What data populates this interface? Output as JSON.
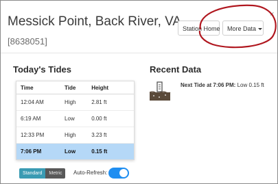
{
  "header": {
    "title": "Messick Point, Back River, VA",
    "station_id": "[8638051]",
    "station_home_label": "Station Home",
    "more_data_label": "More Data",
    "close_symbol": "×"
  },
  "tides": {
    "heading": "Today's Tides",
    "columns": [
      "Time",
      "Tide",
      "Height"
    ],
    "rows": [
      {
        "time": "12:04 AM",
        "tide": "High",
        "height": "2.81 ft"
      },
      {
        "time": "6:19 AM",
        "tide": "Low",
        "height": "0.00 ft"
      },
      {
        "time": "12:33 PM",
        "tide": "High",
        "height": "3.23 ft"
      },
      {
        "time": "7:06 PM",
        "tide": "Low",
        "height": "0.15 ft"
      }
    ]
  },
  "units": {
    "standard_label": "Standard",
    "metric_label": "Metric",
    "selected": "Standard"
  },
  "auto_refresh": {
    "label": "Auto-Refresh:",
    "enabled": true
  },
  "recent": {
    "heading": "Recent Data",
    "next_tide_label": "Next Tide at 7:06 PM:",
    "next_tide_value": "Low 0.15 ft",
    "icon": "tide-gauge-icon"
  },
  "colors": {
    "accent_blue": "#1f8ef1",
    "highlight_row": "#b5d8f7",
    "standard_button": "#3a9bb3",
    "metric_button": "#585858",
    "annotation_red": "#b0171f"
  }
}
